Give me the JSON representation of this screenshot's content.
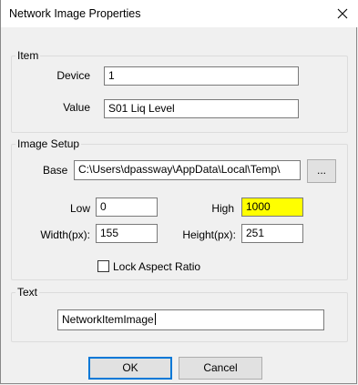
{
  "window": {
    "title": "Network Image Properties"
  },
  "item": {
    "legend": "Item",
    "device_label": "Device",
    "device_value": "1",
    "value_label": "Value",
    "value_value": "S01 Liq Level"
  },
  "image_setup": {
    "legend": "Image Setup",
    "base_label": "Base",
    "base_value": "C:\\Users\\dpassway\\AppData\\Local\\Temp\\",
    "browse_label": "...",
    "low_label": "Low",
    "low_value": "0",
    "high_label": "High",
    "high_value": "1000",
    "high_bg": "#ffff00",
    "width_label": "Width(px):",
    "width_value": "155",
    "height_label": "Height(px):",
    "height_value": "251",
    "lock_label": "Lock Aspect Ratio",
    "lock_checked": false
  },
  "text": {
    "legend": "Text",
    "value": "NetworkItemImage"
  },
  "buttons": {
    "ok": "OK",
    "cancel": "Cancel"
  }
}
